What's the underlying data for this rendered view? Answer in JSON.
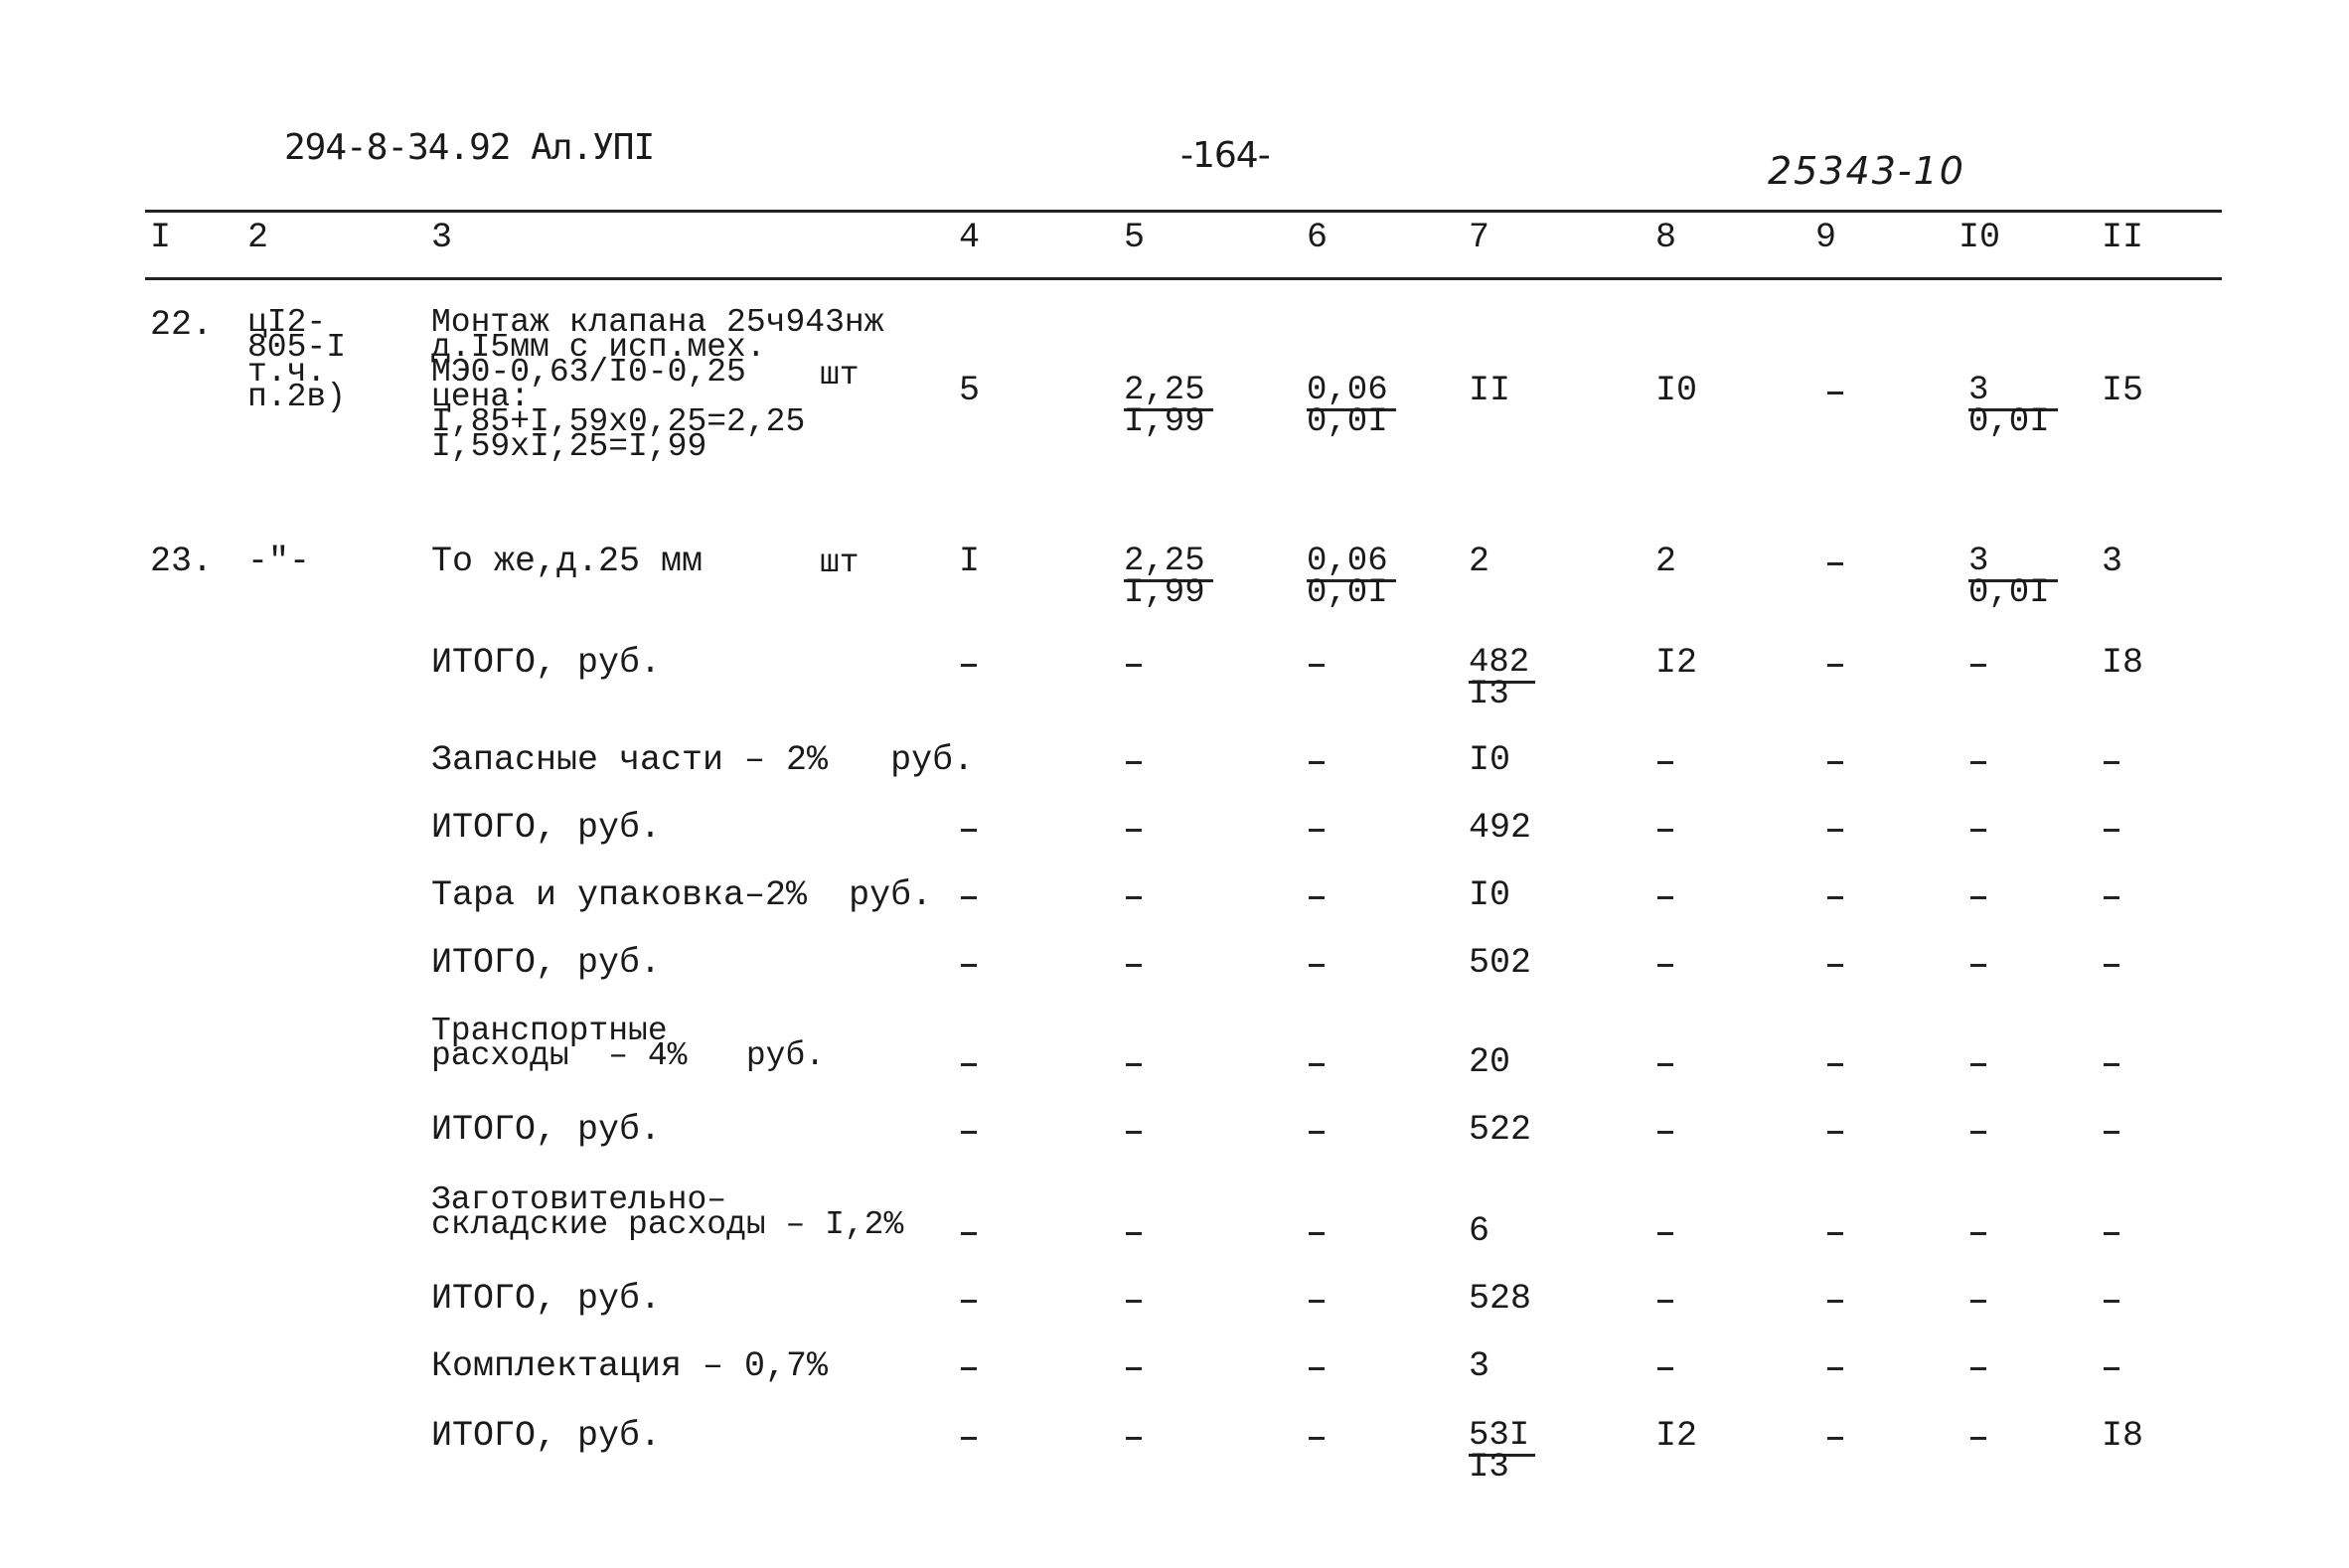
{
  "page_header": {
    "doc_code": "294-8-34.92 Ал.УПI",
    "page_number": "-164-",
    "handwritten_ref": "25343-10"
  },
  "columns": [
    "I",
    "2",
    "3",
    "4",
    "5",
    "6",
    "7",
    "8",
    "9",
    "I0",
    "II"
  ],
  "rows": [
    {
      "num": "22.",
      "code_lines": [
        "цI2-",
        "805-I",
        "т.ч.",
        "п.2в)"
      ],
      "desc_lines": [
        "Монтаж клапана 25ч943нж",
        "д.I5мм с исп.мех.",
        "МЭ0-0,63/I0-0,25",
        "цена:",
        "I,85+I,59x0,25=2,25",
        "I,59xI,25=I,99"
      ],
      "unit": "шт",
      "c4": "5",
      "c5": {
        "num": "2,25",
        "den": "I,99"
      },
      "c6": {
        "num": "0,06",
        "den": "0,0I"
      },
      "c7": "II",
      "c8": "I0",
      "c9": "–",
      "c10": {
        "num": "3",
        "den": "0,0I"
      },
      "c11": "I5"
    },
    {
      "num": "23.",
      "code": "-\"-",
      "desc": "То же,д.25 мм",
      "unit": "шт",
      "c4": "I",
      "c5": {
        "num": "2,25",
        "den": "I,99"
      },
      "c6": {
        "num": "0,06",
        "den": "0,0I"
      },
      "c7": "2",
      "c8": "2",
      "c9": "–",
      "c10": {
        "num": "3",
        "den": "0,0I"
      },
      "c11": "3"
    }
  ],
  "summary": [
    {
      "label_lines": [
        "ИТОГО, руб."
      ],
      "c4": "–",
      "c5": "–",
      "c6": "–",
      "c7": {
        "num": "482",
        "den": "I3"
      },
      "c8": "I2",
      "c9": "–",
      "c10": "–",
      "c11": "I8"
    },
    {
      "label_lines": [
        "Запасные части – 2%   руб."
      ],
      "c4": "",
      "c5": "–",
      "c6": "–",
      "c7": "I0",
      "c8": "–",
      "c9": "–",
      "c10": "–",
      "c11": "–"
    },
    {
      "label_lines": [
        "ИТОГО, руб."
      ],
      "c4": "–",
      "c5": "–",
      "c6": "–",
      "c7": "492",
      "c8": "–",
      "c9": "–",
      "c10": "–",
      "c11": "–"
    },
    {
      "label_lines": [
        "Тара и упаковка–2%  руб."
      ],
      "c4": "–",
      "c5": "–",
      "c6": "–",
      "c7": "I0",
      "c8": "–",
      "c9": "–",
      "c10": "–",
      "c11": "–"
    },
    {
      "label_lines": [
        "ИТОГО, руб."
      ],
      "c4": "–",
      "c5": "–",
      "c6": "–",
      "c7": "502",
      "c8": "–",
      "c9": "–",
      "c10": "–",
      "c11": "–"
    },
    {
      "label_lines": [
        "Транспортные",
        "расходы  – 4%   руб."
      ],
      "c4": "–",
      "c5": "–",
      "c6": "–",
      "c7": "20",
      "c8": "–",
      "c9": "–",
      "c10": "–",
      "c11": "–"
    },
    {
      "label_lines": [
        "ИТОГО, руб."
      ],
      "c4": "–",
      "c5": "–",
      "c6": "–",
      "c7": "522",
      "c8": "–",
      "c9": "–",
      "c10": "–",
      "c11": "–"
    },
    {
      "label_lines": [
        "Заготовительно–",
        "складские расходы – I,2%"
      ],
      "c4": "–",
      "c5": "–",
      "c6": "–",
      "c7": "6",
      "c8": "–",
      "c9": "–",
      "c10": "–",
      "c11": "–"
    },
    {
      "label_lines": [
        "ИТОГО, руб."
      ],
      "c4": "–",
      "c5": "–",
      "c6": "–",
      "c7": "528",
      "c8": "–",
      "c9": "–",
      "c10": "–",
      "c11": "–"
    },
    {
      "label_lines": [
        "Комплектация – 0,7%"
      ],
      "c4": "–",
      "c5": "–",
      "c6": "–",
      "c7": "3",
      "c8": "–",
      "c9": "–",
      "c10": "–",
      "c11": "–"
    },
    {
      "label_lines": [
        "ИТОГО, руб."
      ],
      "c4": "–",
      "c5": "–",
      "c6": "–",
      "c7": {
        "num": "53I",
        "den": "I3"
      },
      "c8": "I2",
      "c9": "–",
      "c10": "–",
      "c11": "I8"
    }
  ]
}
